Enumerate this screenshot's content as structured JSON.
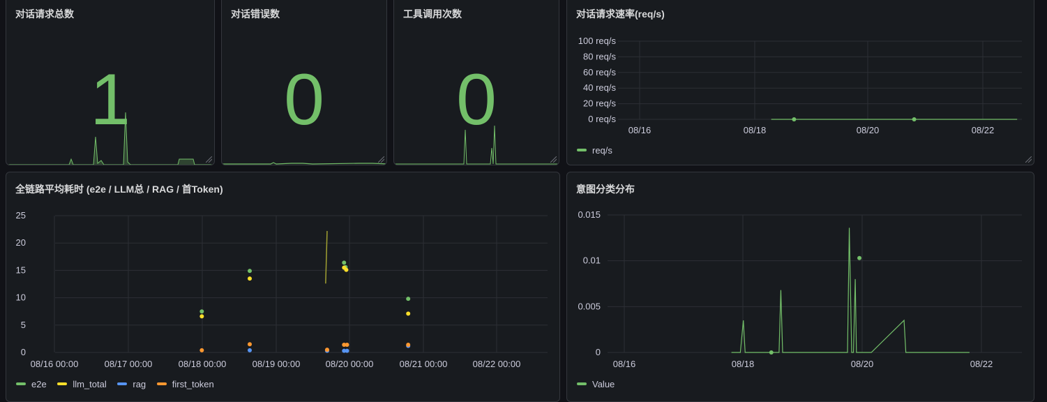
{
  "panels": {
    "total": {
      "title": "对话请求总数",
      "value": "1"
    },
    "errors": {
      "title": "对话错误数",
      "value": "0"
    },
    "tools": {
      "title": "工具调用次数",
      "value": "0"
    },
    "rate": {
      "title": "对话请求速率(req/s)"
    },
    "latency": {
      "title": "全链路平均耗时 (e2e / LLM总 / RAG / 首Token)"
    },
    "intent": {
      "title": "意图分类分布"
    }
  },
  "colors": {
    "green": "#73bf69",
    "yellow": "#fade2a",
    "blue": "#5794f2",
    "orange": "#ff9830"
  },
  "chart_data": [
    {
      "id": "rate",
      "type": "line",
      "title": "对话请求速率(req/s)",
      "yticks": [
        "100 req/s",
        "80 req/s",
        "60 req/s",
        "40 req/s",
        "20 req/s",
        "0 req/s"
      ],
      "ylim": [
        0,
        100
      ],
      "xticks": [
        "08/16",
        "08/18",
        "08/20",
        "08/22"
      ],
      "series": [
        {
          "name": "req/s",
          "color": "#73bf69",
          "points": [
            [
              2.3,
              0
            ],
            [
              2.5,
              0
            ],
            [
              2.6,
              0
            ],
            [
              3.3,
              0
            ],
            [
              3.8,
              0
            ],
            [
              4.6,
              0
            ],
            [
              6.3,
              0
            ],
            [
              6.6,
              0
            ]
          ],
          "dots": [
            [
              2.7,
              0
            ],
            [
              4.8,
              0
            ]
          ]
        }
      ],
      "legend": [
        "req/s"
      ]
    },
    {
      "id": "latency",
      "type": "scatter",
      "title": "全链路平均耗时 (e2e / LLM总 / RAG / 首Token)",
      "yticks": [
        "25",
        "20",
        "15",
        "10",
        "5",
        "0"
      ],
      "ylim": [
        0,
        25
      ],
      "xticks": [
        "08/16 00:00",
        "08/17 00:00",
        "08/18 00:00",
        "08/19 00:00",
        "08/20 00:00",
        "08/21 00:00",
        "08/22 00:00"
      ],
      "series": [
        {
          "name": "e2e",
          "color": "#73bf69",
          "points": [
            [
              2.0,
              7.5
            ],
            [
              2.65,
              14.9
            ],
            [
              3.93,
              16.4
            ],
            [
              3.95,
              15.6
            ],
            [
              4.8,
              9.8
            ]
          ]
        },
        {
          "name": "llm_total",
          "color": "#fade2a",
          "points": [
            [
              2.0,
              6.6
            ],
            [
              2.65,
              13.5
            ],
            [
              3.93,
              15.5
            ],
            [
              3.96,
              15.1
            ],
            [
              4.8,
              7.1
            ]
          ]
        },
        {
          "name": "rag",
          "color": "#5794f2",
          "points": [
            [
              2.65,
              0.4
            ],
            [
              3.7,
              0.3
            ],
            [
              3.93,
              0.3
            ],
            [
              3.97,
              0.3
            ],
            [
              4.8,
              1.2
            ]
          ]
        },
        {
          "name": "first_token",
          "color": "#ff9830",
          "points": [
            [
              2.0,
              0.4
            ],
            [
              2.65,
              1.5
            ],
            [
              3.7,
              0.5
            ],
            [
              3.93,
              1.4
            ],
            [
              3.97,
              1.4
            ],
            [
              4.8,
              1.4
            ]
          ]
        }
      ],
      "spike": {
        "color": "#a0a032",
        "points": [
          [
            3.68,
            12.6
          ],
          [
            3.7,
            22.2
          ]
        ]
      },
      "legend": [
        "e2e",
        "llm_total",
        "rag",
        "first_token"
      ]
    },
    {
      "id": "intent",
      "type": "line",
      "title": "意图分类分布",
      "yticks": [
        "0.015",
        "0.01",
        "0.005",
        "0"
      ],
      "ylim": [
        0,
        0.015
      ],
      "xticks": [
        "08/16",
        "08/18",
        "08/20",
        "08/22"
      ],
      "series": [
        {
          "name": "Value",
          "color": "#73bf69",
          "points": [
            [
              1.8,
              0
            ],
            [
              1.95,
              0
            ],
            [
              2.0,
              0.0035
            ],
            [
              2.03,
              0
            ],
            [
              2.6,
              0
            ],
            [
              2.63,
              0.0068
            ],
            [
              2.66,
              0
            ],
            [
              3.0,
              0
            ],
            [
              3.75,
              0
            ],
            [
              3.78,
              0.0136
            ],
            [
              3.82,
              0
            ],
            [
              3.85,
              0
            ],
            [
              3.88,
              0.008
            ],
            [
              3.9,
              0
            ],
            [
              4.15,
              0
            ],
            [
              4.7,
              0.0035
            ],
            [
              4.73,
              0
            ],
            [
              5.3,
              0
            ],
            [
              5.8,
              0
            ]
          ],
          "dots": [
            [
              2.47,
              0
            ],
            [
              3.95,
              0.0103
            ]
          ]
        }
      ],
      "legend": [
        "Value"
      ]
    }
  ]
}
